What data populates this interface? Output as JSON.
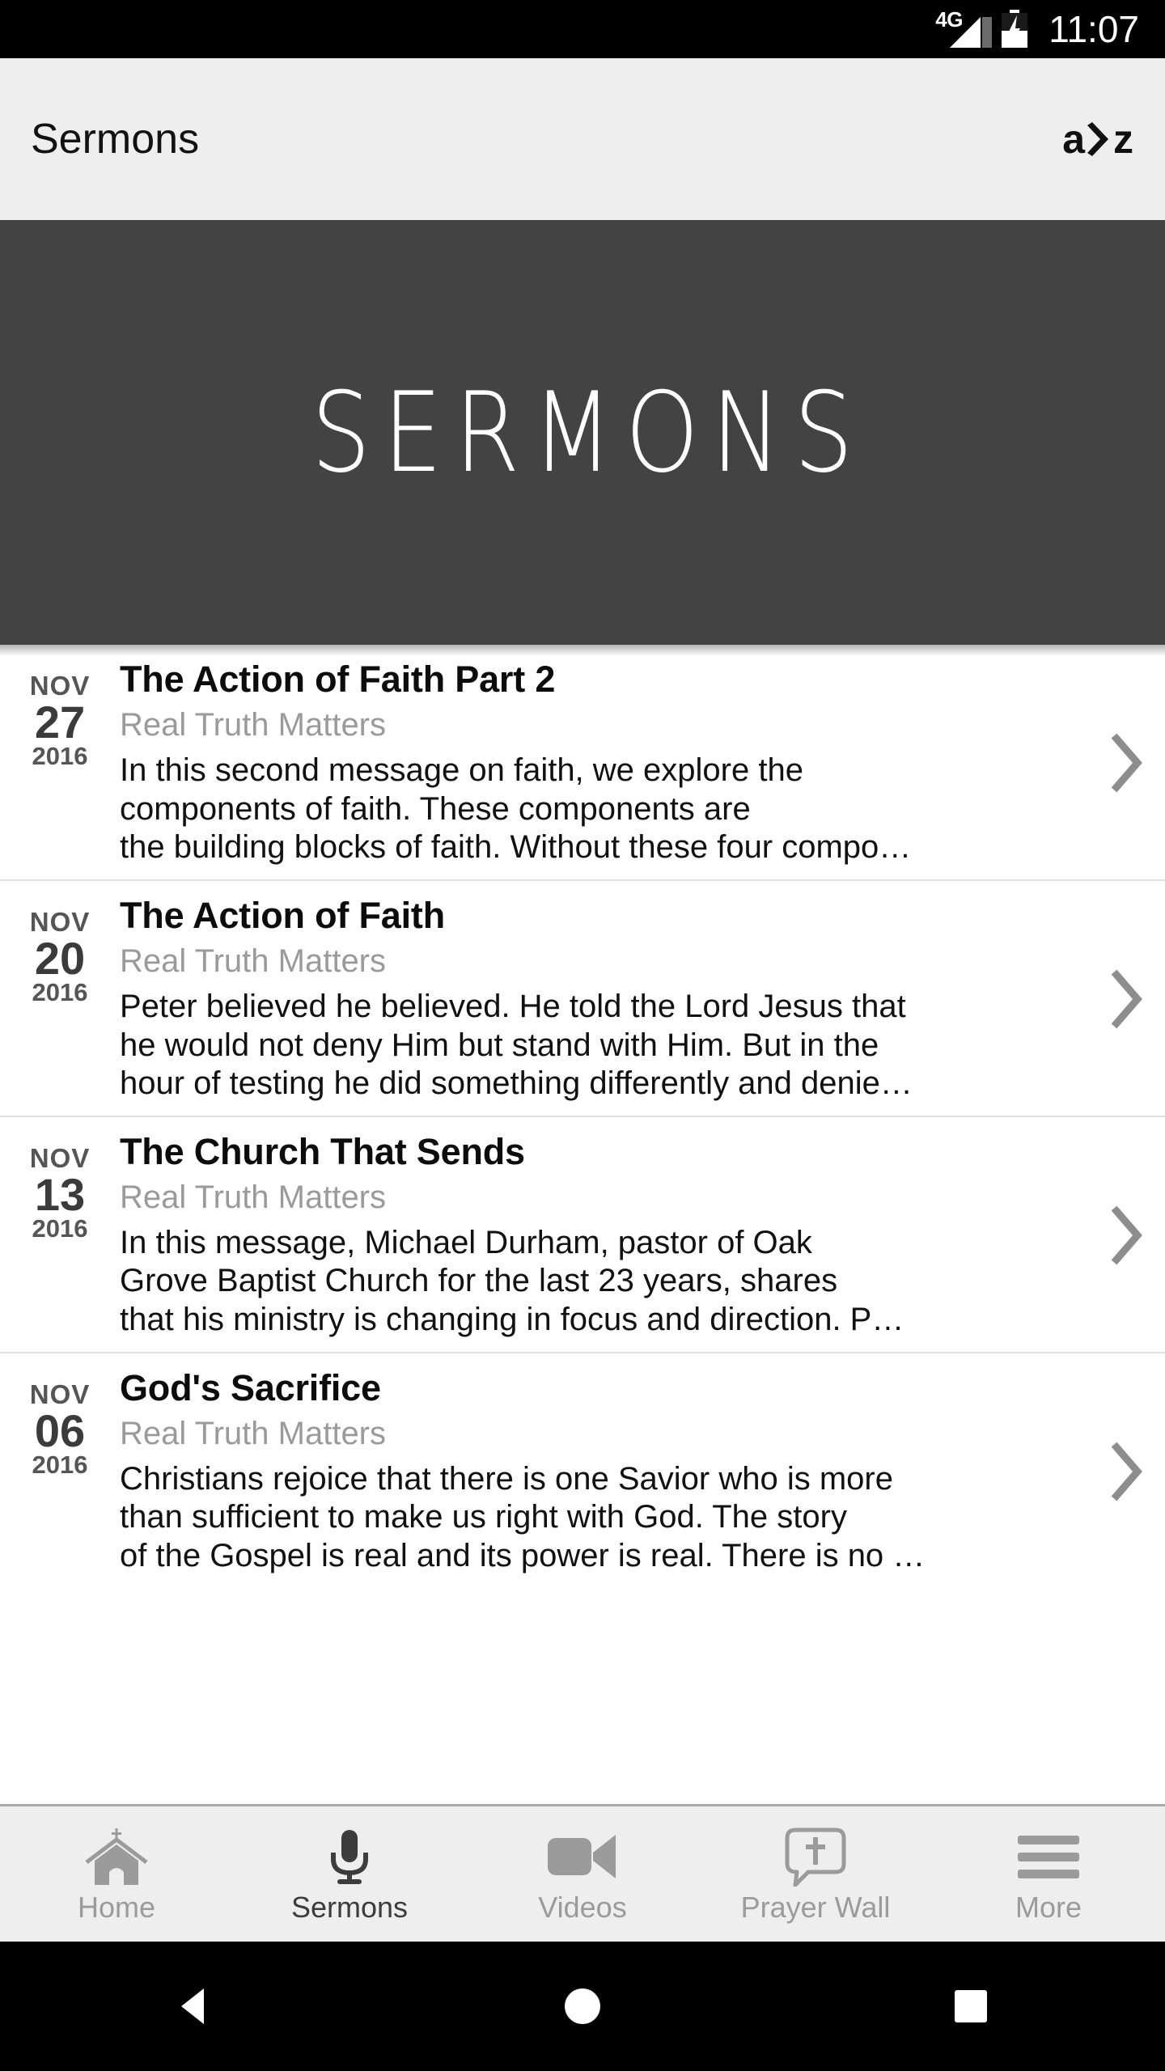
{
  "statusbar": {
    "network_label": "4G",
    "time": "11:07",
    "signal_icon": "signal-bars-icon",
    "battery_icon": "battery-charging-icon"
  },
  "appbar": {
    "title": "Sermons",
    "brand": {
      "left": "a",
      "chevron": "›",
      "right": "z"
    }
  },
  "hero": {
    "title": "SERMONS",
    "background_color": "#434343"
  },
  "list": {
    "items": [
      {
        "month": "NOV",
        "day": "27",
        "year": "2016",
        "title": "The Action of Faith Part 2",
        "subtitle": "Real Truth Matters",
        "description": "In this second message on faith, we explore the\ncomponents of faith. These components are\nthe building blocks of faith. Without these four compo…"
      },
      {
        "month": "NOV",
        "day": "20",
        "year": "2016",
        "title": "The Action of Faith",
        "subtitle": "Real Truth Matters",
        "description": "Peter believed he believed. He told the Lord Jesus that\nhe would not deny Him but stand with Him. But in the\nhour of testing he did something differently and denie…"
      },
      {
        "month": "NOV",
        "day": "13",
        "year": "2016",
        "title": "The Church That Sends",
        "subtitle": "Real Truth Matters",
        "description": "In this message, Michael Durham, pastor of Oak\nGrove Baptist Church for the last 23 years, shares\nthat his ministry is changing in focus and direction. P…"
      },
      {
        "month": "NOV",
        "day": "06",
        "year": "2016",
        "title": "God's Sacrifice",
        "subtitle": "Real Truth Matters",
        "description": "Christians rejoice that there is one Savior who is more\nthan sufficient to make us right with God. The story\nof the Gospel is real and its power is real. There is no …"
      }
    ],
    "chevron_icon": "chevron-right-icon"
  },
  "tabbar": {
    "items": [
      {
        "label": "Home",
        "icon": "church-icon",
        "active": false
      },
      {
        "label": "Sermons",
        "icon": "microphone-icon",
        "active": true
      },
      {
        "label": "Videos",
        "icon": "video-camera-icon",
        "active": false
      },
      {
        "label": "Prayer Wall",
        "icon": "speech-bubble-cross-icon",
        "active": false
      },
      {
        "label": "More",
        "icon": "hamburger-menu-icon",
        "active": false
      }
    ],
    "inactive_color": "#9b9b9b",
    "active_color": "#3c3c3c"
  },
  "androidnav": {
    "back_icon": "back-triangle-icon",
    "home_icon": "home-circle-icon",
    "recents_icon": "recents-square-icon"
  }
}
